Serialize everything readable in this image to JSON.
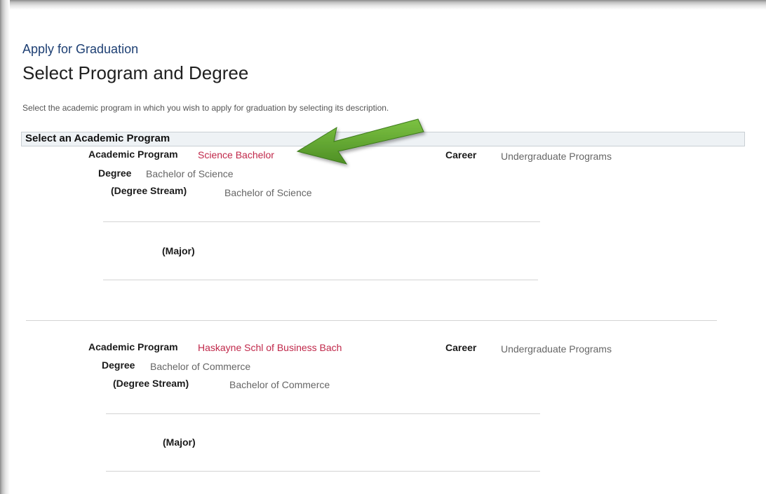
{
  "header": {
    "breadcrumb": "Apply for Graduation",
    "title": "Select Program and Degree",
    "instructions": "Select the academic program in which you wish to apply for graduation by selecting its description."
  },
  "section": {
    "title": "Select an Academic Program"
  },
  "labels": {
    "academic_program": "Academic Program",
    "career": "Career",
    "degree": "Degree",
    "degree_stream": "(Degree  Stream)",
    "major": "(Major)"
  },
  "programs": [
    {
      "academic_program": "Science Bachelor",
      "career": "Undergraduate Programs",
      "degree": "Bachelor of Science",
      "degree_stream": "Bachelor of Science"
    },
    {
      "academic_program": "Haskayne Schl of Business Bach",
      "career": "Undergraduate Programs",
      "degree": "Bachelor of Commerce",
      "degree_stream": "Bachelor of Commerce"
    }
  ],
  "colors": {
    "link": "#c0284a",
    "annotation_arrow": "#5fa630"
  },
  "annotation": {
    "icon": "green-arrow-icon"
  }
}
